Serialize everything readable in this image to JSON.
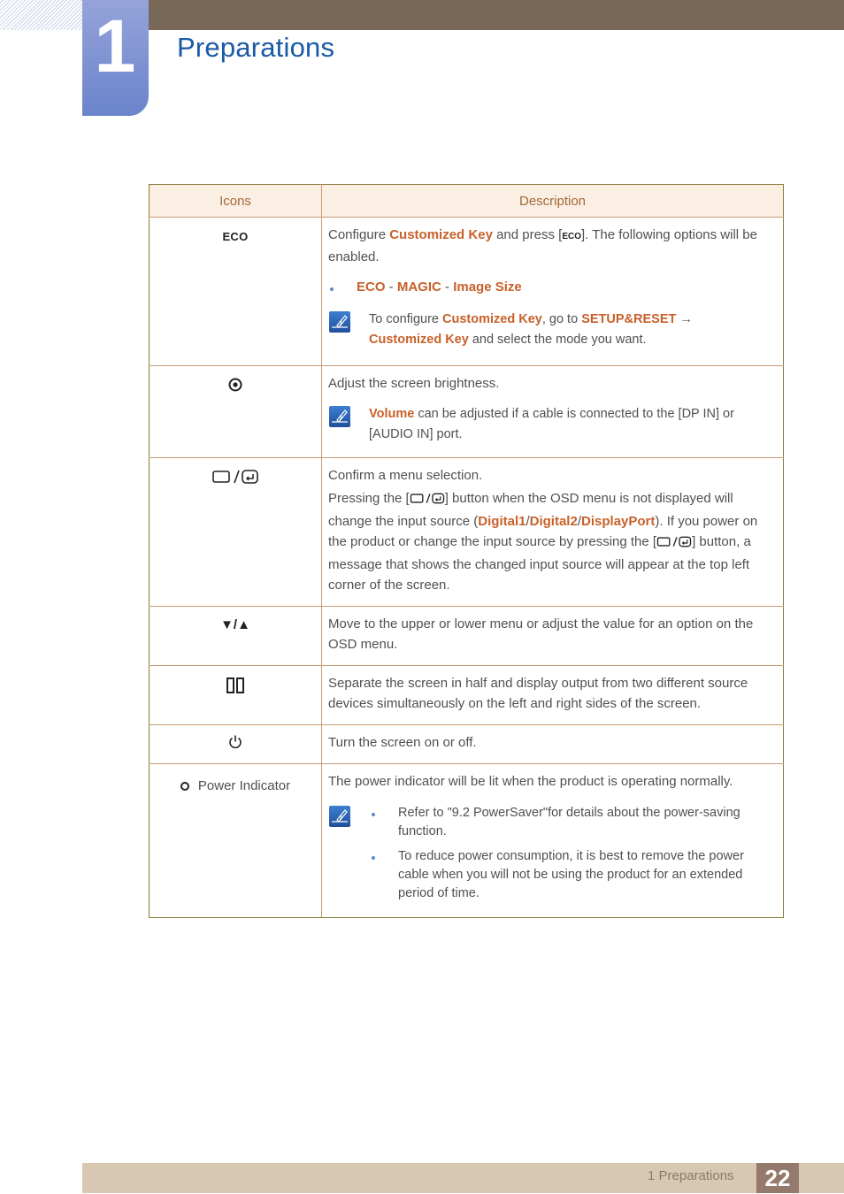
{
  "chapter": {
    "number": "1",
    "title": "Preparations"
  },
  "table": {
    "headers": {
      "icons": "Icons",
      "description": "Description"
    },
    "rows": [
      {
        "icon": "eco-icon",
        "icon_text": "ECO",
        "desc": {
          "p1_a": "Configure ",
          "p1_hl1": "Customized Key",
          "p1_b": " and press [",
          "p1_icon_text": "ECO",
          "p1_c": "]. The following options will be enabled.",
          "bullet_hl1": "ECO",
          "bullet_sep1": " - ",
          "bullet_hl2": "MAGIC",
          "bullet_sep2": " - ",
          "bullet_hl3": "Image Size",
          "note_a": "To configure ",
          "note_hl1": "Customized Key",
          "note_b": ", go to ",
          "note_hl2": "SETUP&RESET",
          "note_c": " → ",
          "note_hl3": "Customized Key",
          "note_d": " and select the mode you want."
        }
      },
      {
        "icon": "brightness-icon",
        "desc": {
          "p1": "Adjust the screen brightness.",
          "note_hl1": "Volume",
          "note_a": " can be adjusted if a cable is connected to the [DP IN] or [AUDIO IN] port."
        }
      },
      {
        "icon": "source-enter-icon",
        "desc": {
          "p1": "Confirm a menu selection.",
          "p2_a": "Pressing the [",
          "p2_b": "] button when the OSD menu is not displayed will change the input source (",
          "p2_hl1": "Digital1",
          "p2_s1": "/",
          "p2_hl2": "Digital2",
          "p2_s2": "/",
          "p2_hl3": "DisplayPort",
          "p2_c": "). If you power on the product or change the input source by pressing the [",
          "p2_d": "] button, a message that shows the changed input source will appear at the top left corner of the screen."
        }
      },
      {
        "icon": "down-up-arrows-icon",
        "icon_text": "▼/▲",
        "desc": {
          "p1": "Move to the upper or lower menu or adjust the value for an option on the OSD menu."
        }
      },
      {
        "icon": "pip-split-screen-icon",
        "desc": {
          "p1": "Separate the screen in half and display output from two different source devices simultaneously on the left and right sides of the screen."
        }
      },
      {
        "icon": "power-icon",
        "desc": {
          "p1": "Turn the screen on or off."
        }
      },
      {
        "icon": "power-indicator-icon",
        "icon_label": "Power Indicator",
        "desc": {
          "p1": "The power indicator will be lit when the product is operating normally.",
          "note_items": [
            "Refer to \"9.2 PowerSaver\"for details about the power-saving function.",
            "To reduce power consumption, it is best to remove the power cable when you will not be using the product for an extended period of time."
          ]
        }
      }
    ]
  },
  "footer": {
    "section": "1 Preparations",
    "page": "22"
  },
  "colors": {
    "highlight": "#c8602a",
    "title": "#1a5aa6",
    "header_bar": "#776858",
    "footer_bar": "#d8c8b2",
    "page_box": "#947a6c"
  }
}
